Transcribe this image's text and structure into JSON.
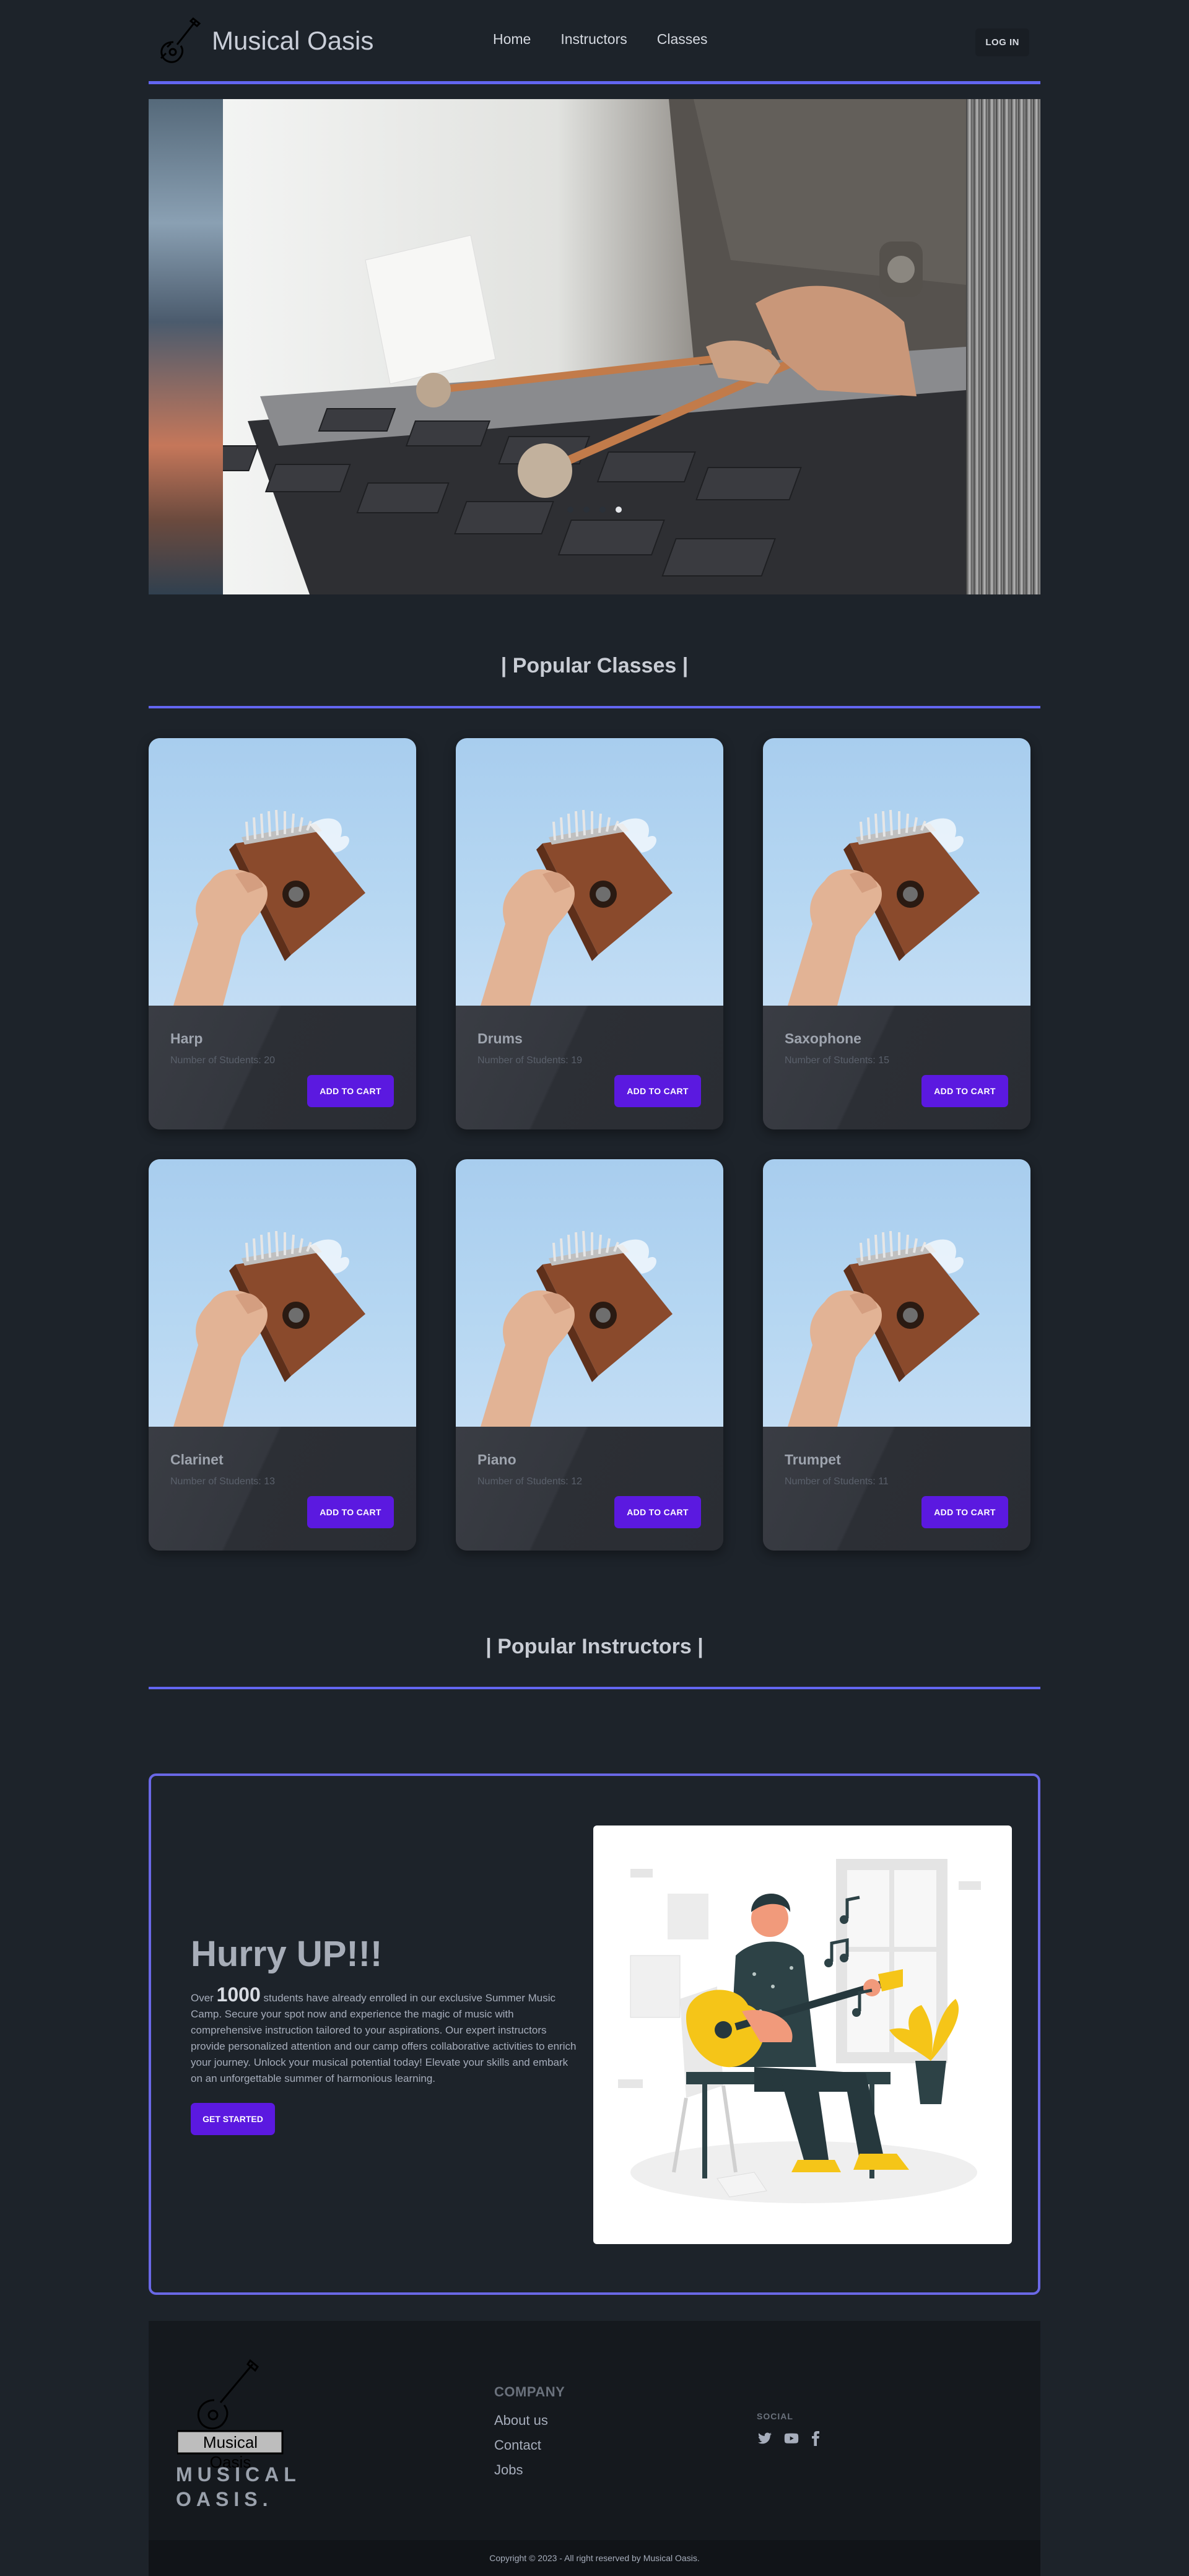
{
  "navbar": {
    "brand_name": "Musical Oasis",
    "links": [
      "Home",
      "Instructors",
      "Classes"
    ],
    "login_label": "LOG IN",
    "accent": "#6366f1"
  },
  "hero": {
    "slide_count": 4,
    "active_slide": 4
  },
  "popular_classes": {
    "title": "| Popular Classes |",
    "classes": [
      {
        "name": "Harp",
        "students": "Number of Students: 20",
        "button": "ADD TO CART"
      },
      {
        "name": "Drums",
        "students": "Number of Students: 19",
        "button": "ADD TO CART"
      },
      {
        "name": "Saxophone",
        "students": "Number of Students: 15",
        "button": "ADD TO CART"
      },
      {
        "name": "Clarinet",
        "students": "Number of Students: 13",
        "button": "ADD TO CART"
      },
      {
        "name": "Piano",
        "students": "Number of Students: 12",
        "button": "ADD TO CART"
      },
      {
        "name": "Trumpet",
        "students": "Number of Students: 11",
        "button": "ADD TO CART"
      }
    ]
  },
  "popular_instructors": {
    "title": "| Popular Instructors |"
  },
  "hurry": {
    "title": "Hurry UP!!!",
    "text_prefix": "Over ",
    "count": "1000",
    "text_body": " students have already enrolled in our exclusive Summer Music Camp. Secure your spot now and experience the magic of music with comprehensive instruction tailored to your aspirations. Our expert instructors provide personalized attention and our camp offers collaborative activities to enrich your journey. Unlock your musical potential today! Elevate your skills and embark on an unforgettable summer of harmonious learning.",
    "button": "GET STARTED"
  },
  "footer": {
    "logo_badge": "Musical Oasis",
    "logo_text_line1": "MUSICAL",
    "logo_text_line2": "OASIS.",
    "company_title": "COMPANY",
    "company_links": [
      "About us",
      "Contact",
      "Jobs"
    ],
    "social_title": "SOCIAL",
    "social_icons": [
      "twitter-icon",
      "youtube-icon",
      "facebook-icon"
    ],
    "copyright": "Copyright © 2023 - All right reserved by Musical Oasis."
  },
  "colors": {
    "background": "#1d232a",
    "button": "#5b19e0",
    "accent": "#6366f1"
  }
}
